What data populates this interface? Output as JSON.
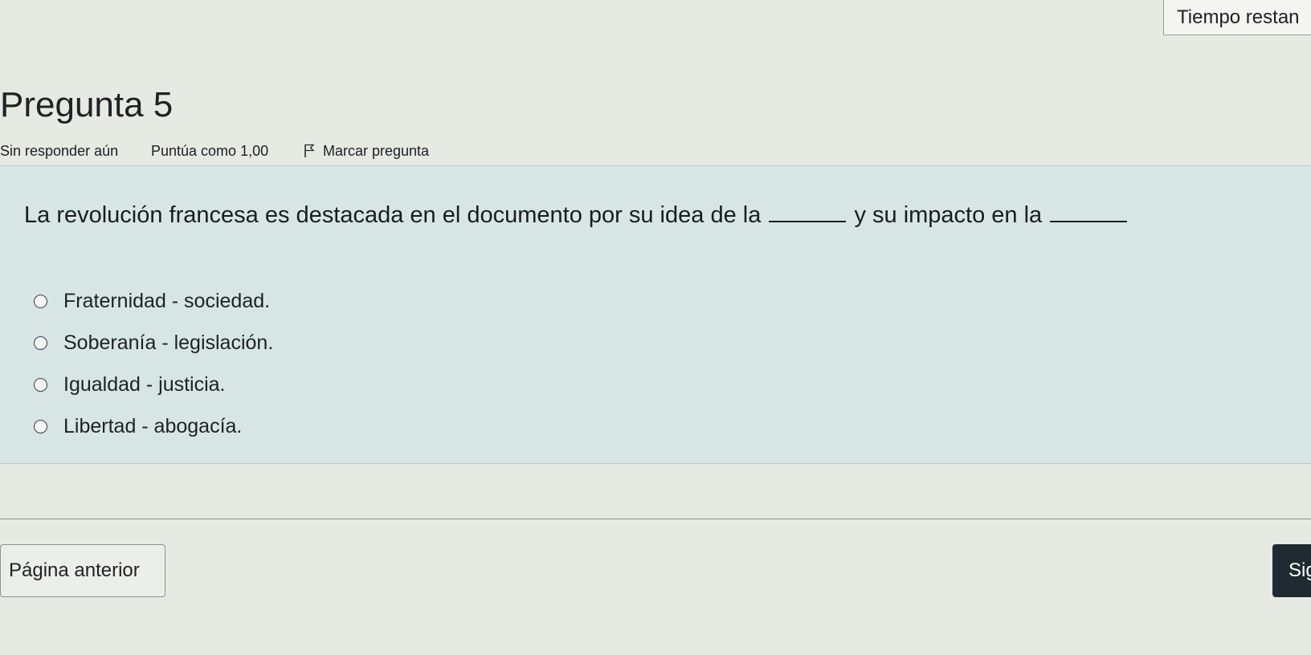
{
  "timer": {
    "label": "Tiempo restan"
  },
  "question": {
    "title": "Pregunta 5",
    "status": "Sin responder aún",
    "grade": "Puntúa como 1,00",
    "flag_label": "Marcar pregunta",
    "text_part1": "La revolución francesa es destacada en el documento por su idea de la",
    "text_part2": "y su impacto en la",
    "options": [
      {
        "label": "Fraternidad - sociedad."
      },
      {
        "label": "Soberanía - legislación."
      },
      {
        "label": "Igualdad - justicia."
      },
      {
        "label": "Libertad - abogacía."
      }
    ]
  },
  "nav": {
    "prev_label": "Página anterior",
    "next_label": "Sig"
  }
}
